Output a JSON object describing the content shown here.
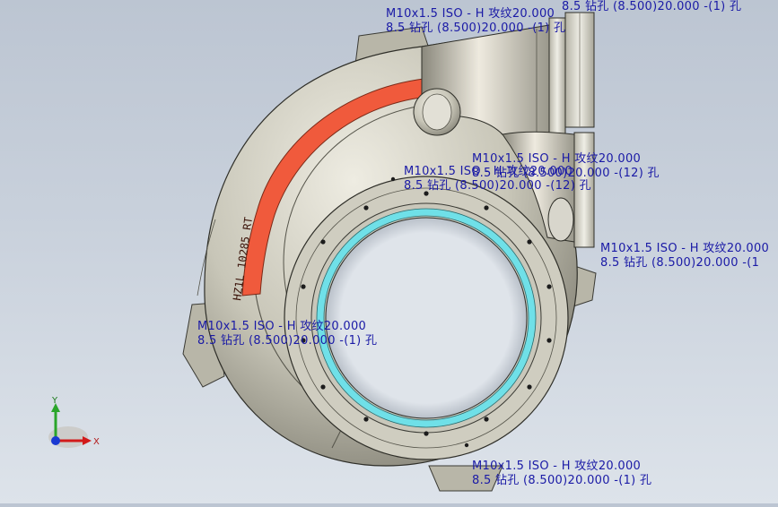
{
  "colors": {
    "annotation": "#1a1aa6",
    "body": "#c8c6b8",
    "body_dark": "#8f8d80",
    "label_band": "#f05a3c",
    "ring_cyan": "#6fe0e8",
    "axis_x": "#d21a1a",
    "axis_y": "#2aa52a",
    "axis_z": "#1a3ad2"
  },
  "annotations": [
    {
      "line1": "M10x1.5 ISO - H 攻纹20.000",
      "line2": "8.5 钻孔 (8.500)20.000 -(1) 孔",
      "partial": "8.5 钻孔 (8.500)20.000 -(1) 孔"
    },
    {
      "line1": "M10x1.5 ISO - H 攻纹20.000",
      "line2": "8.5 钻孔 (8.500)20.000 -(12) 孔"
    },
    {
      "line1": "M10x1.5 ISO - H 攻纹20.000",
      "line2": "8.5 钻孔 (8.500)20.000 -(12) 孔"
    },
    {
      "line1": "M10x1.5 ISO - H 攻纹20.000",
      "line2": "8.5 钻孔 (8.500)20.000 -(1"
    },
    {
      "line1": "M10x1.5 ISO - H 攻纹20.000",
      "line2": "8.5 钻孔 (8.500)20.000 -(1) 孔"
    },
    {
      "line1": "M10x1.5 ISO - H 攻纹20.000",
      "line2": "8.5 钻孔 (8.500)20.000 -(1) 孔"
    }
  ],
  "engraving": "HZ1L 10285 RT",
  "triad": {
    "x_label": "X",
    "y_label": "Y"
  },
  "icons": [
    "view-triad-icon"
  ]
}
